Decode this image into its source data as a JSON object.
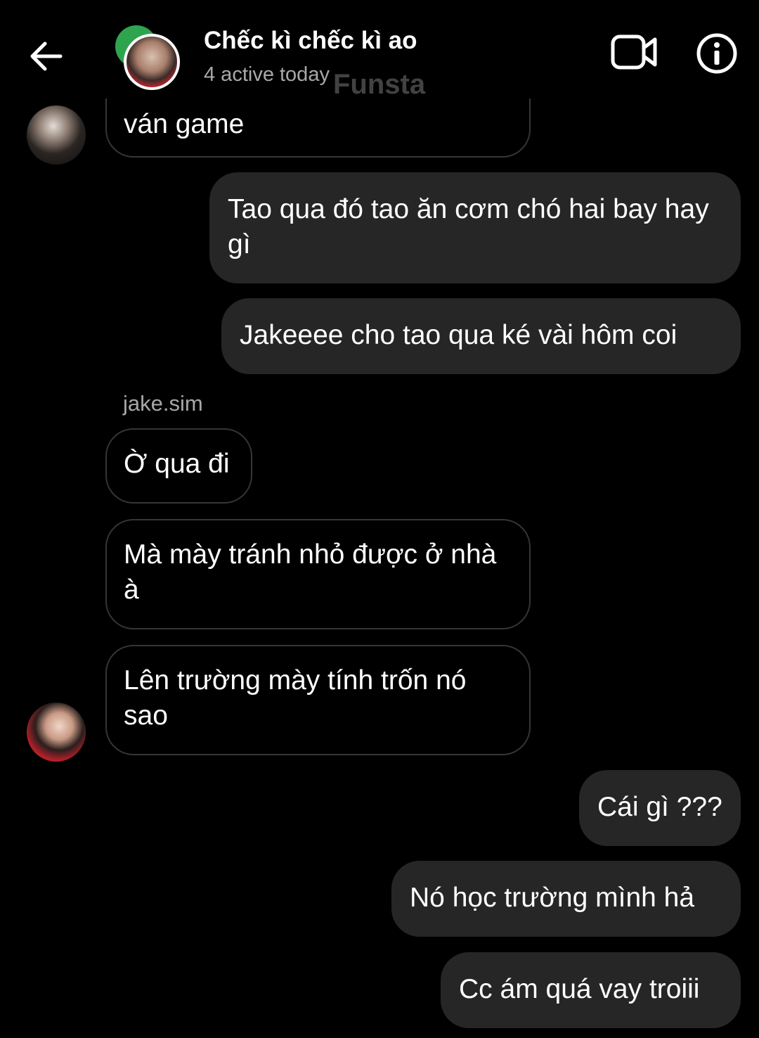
{
  "header": {
    "title": "Chếc kì chếc kì ao",
    "status": "4 active today",
    "watermark": "Funsta"
  },
  "messages": [
    {
      "direction": "incoming",
      "text": "ván game"
    },
    {
      "direction": "outgoing",
      "text": "Tao qua đó tao ăn cơm chó hai bay hay gì"
    },
    {
      "direction": "outgoing",
      "text": "Jakeeee cho tao qua ké vài hôm coi"
    },
    {
      "direction": "incoming",
      "sender": "jake.sim",
      "text": "Ờ qua đi"
    },
    {
      "direction": "incoming",
      "text": "Mà mày tránh nhỏ được ở nhà à"
    },
    {
      "direction": "incoming",
      "text": "Lên trường mày tính trốn nó sao"
    },
    {
      "direction": "outgoing",
      "text": "Cái gì ???"
    },
    {
      "direction": "outgoing",
      "text": "Nó học trường mình hả"
    },
    {
      "direction": "outgoing",
      "text": "Cc ám quá vay troiii"
    }
  ],
  "icons": {
    "back": "arrow-left-icon",
    "video": "video-camera-icon",
    "info": "info-icon"
  },
  "colors": {
    "background": "#000000",
    "outgoing_bubble": "#262626",
    "incoming_border": "#363636",
    "secondary_text": "#a8a8a8"
  }
}
